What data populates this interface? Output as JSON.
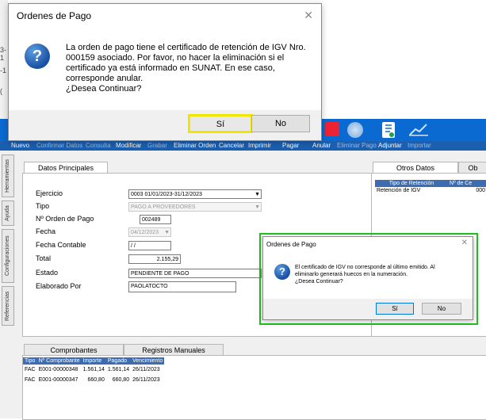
{
  "background_app": {
    "left_fragments": [
      "3-1",
      "-1",
      "("
    ],
    "toolbar": {
      "labels": [
        "Nuevo",
        "Confirmar Datos",
        "Consulta",
        "Modificar",
        "Grabar",
        "Eliminar Orden",
        "Cancelar",
        "Imprimir",
        "Pagar",
        "Anular",
        "Eliminar Pago",
        "Adjuntar",
        "Importar"
      ]
    },
    "side_tabs": [
      "Herramientas",
      "Ayuda",
      "Configuraciones",
      "Referencias"
    ],
    "main_panel": {
      "tab": "Datos Principales",
      "fields": {
        "ejercicio_label": "Ejercicio",
        "ejercicio_value": "0003 01/01/2023-31/12/2023",
        "tipo_label": "Tipo",
        "tipo_value": "PAGO A PROVEEDORES",
        "orden_label": "Nº Orden de Pago",
        "orden_value": "002489",
        "fecha_label": "Fecha",
        "fecha_value": "04/12/2023",
        "fecha_contable_label": "Fecha Contable",
        "fecha_contable_value": "/ /",
        "total_label": "Total",
        "total_value": "2.155,29",
        "estado_label": "Estado",
        "estado_value": "PENDIENTE DE PAGO",
        "elaborado_label": "Elaborado Por",
        "elaborado_value": "PAOLATOCTO"
      }
    },
    "right_panel": {
      "tabs": [
        "Otros Datos",
        "Ob"
      ],
      "columns": [
        "Tipo de Retención",
        "Nº de Ce"
      ],
      "rows": [
        [
          "Retención de IGV",
          "000"
        ]
      ]
    },
    "bottom_panel": {
      "tabs": [
        "Comprobantes",
        "Registros Manuales"
      ],
      "columns": [
        "Tipo",
        "Nº Comprobante",
        "Importe",
        "Pagado",
        "Vencimiento"
      ],
      "rows": [
        [
          "FAC",
          "E001-00000348",
          "1.561,14",
          "1.561,14",
          "26/11/2023"
        ],
        [
          "FAC",
          "E001-00000347",
          "660,80",
          "660,80",
          "26/11/2023"
        ]
      ]
    }
  },
  "dialog_main": {
    "title": "Ordenes de Pago",
    "message_lines": [
      "La orden de pago tiene el certificado de retención de IGV Nro.",
      "000159 asociado. Por favor, no hacer la eliminación si el",
      "certificado ya está informado en SUNAT. En ese caso,",
      "corresponde anular.",
      "¿Desea Continuar?"
    ],
    "yes_label": "Sí",
    "no_label": "No"
  },
  "dialog_secondary": {
    "title": "Ordenes de Pago",
    "message_lines": [
      "El certificado de IGV no corresponde al último emitido. Al",
      "eliminarlo generará huecos en la numeración.",
      "¿Desea Continuar?"
    ],
    "yes_label": "Sí",
    "no_label": "No"
  },
  "colors": {
    "toolbar_blue": "#0a6ad1",
    "grid_header": "#3d6db0",
    "highlight_yellow": "#f2e600",
    "highlight_green": "#22c022"
  }
}
